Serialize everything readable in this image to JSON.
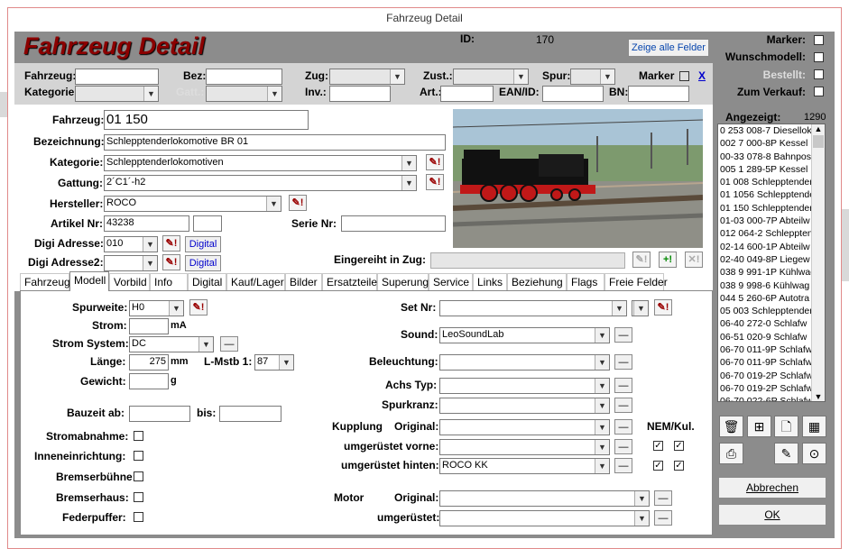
{
  "window": {
    "title": "Fahrzeug Detail"
  },
  "header": {
    "title": "Fahrzeug Detail",
    "id_label": "ID:",
    "id_value": "170",
    "show_all_button": "Zeige alle Felder"
  },
  "side_flags": [
    {
      "label": "Marker:",
      "checked": false
    },
    {
      "label": "Wunschmodell:",
      "checked": false
    },
    {
      "label": "Bestellt:",
      "checked": false,
      "disabled": true
    },
    {
      "label": "Zum Verkauf:",
      "checked": false
    }
  ],
  "filter": {
    "fahrzeug": "Fahrzeug:",
    "bez": "Bez:",
    "zug": "Zug:",
    "zust": "Zust.:",
    "spur": "Spur:",
    "marker": "Marker",
    "clear": "X",
    "kategorie": "Kategorie:",
    "gatt": "Gatt.:",
    "inv": "Inv.:",
    "art": "Art.:",
    "ean": "EAN/ID:",
    "bn": "BN:"
  },
  "form": {
    "fahrzeug_label": "Fahrzeug:",
    "fahrzeug_value": "01 150",
    "bezeichnung_label": "Bezeichnung:",
    "bezeichnung_value": "Schlepptenderlokomotive BR 01",
    "kategorie_label": "Kategorie:",
    "kategorie_value": "Schlepptenderlokomotiven",
    "gattung_label": "Gattung:",
    "gattung_value": "2´C1´-h2",
    "hersteller_label": "Hersteller:",
    "hersteller_value": "ROCO",
    "artikel_label": "Artikel Nr:",
    "artikel_value": "43238",
    "serie_label": "Serie Nr:",
    "digi1_label": "Digi Adresse:",
    "digi1_value": "010",
    "digital_btn": "Digital",
    "digi2_label": "Digi Adresse2:",
    "eingereiht_label": "Eingereiht in Zug:"
  },
  "tabs": [
    "Fahrzeug",
    "Modell",
    "Vorbild",
    "Info",
    "Digital",
    "Kauf/Lager",
    "Bilder",
    "Ersatzteile",
    "Superung",
    "Service",
    "Links",
    "Beziehung",
    "Flags",
    "Freie Felder"
  ],
  "active_tab": "Modell",
  "modell": {
    "spurweite_label": "Spurweite:",
    "spurweite_value": "H0",
    "strom_label": "Strom:",
    "strom_unit": "mA",
    "stromsystem_label": "Strom System:",
    "stromsystem_value": "DC",
    "laenge_label": "Länge:",
    "laenge_value": "275",
    "laenge_unit": "mm",
    "mstb_label": "L-Mstb 1:",
    "mstb_value": "87",
    "gewicht_label": "Gewicht:",
    "gewicht_unit": "g",
    "bauzeit_label": "Bauzeit ab:",
    "bis_label": "bis:",
    "checks": [
      "Stromabnahme:",
      "Inneneinrichtung:",
      "Bremserbühne:",
      "Bremserhaus:",
      "Federpuffer:"
    ],
    "setnr_label": "Set Nr:",
    "sound_label": "Sound:",
    "sound_value": "LeoSoundLab",
    "beleuchtung_label": "Beleuchtung:",
    "achstyp_label": "Achs Typ:",
    "spurkranz_label": "Spurkranz:",
    "kupplung_label": "Kupplung",
    "original_label": "Original:",
    "vorne_label": "umgerüstet vorne:",
    "hinten_label": "umgerüstet hinten:",
    "hinten_value": "ROCO KK",
    "nem_label": "NEM/Kul.",
    "motor_label": "Motor",
    "motor_original_label": "Original:",
    "motor_umg_label": "umgerüstet:"
  },
  "list": {
    "label": "Angezeigt:",
    "count": "1290",
    "items": [
      "0 253 008-7 Diesellok",
      "002 7 000-8P Kessel",
      "00-33 078-8 Bahnpost",
      "005 1 289-5P Kessel",
      "01 008 Schlepptender",
      "01 1056 Schlepptender",
      "01 150 Schlepptender",
      "01-03 000-7P Abteilw",
      "012 064-2 Schlepptender",
      "02-14 600-1P Abteilw",
      "02-40 049-8P Liegew",
      "038 9 991-1P Kühlwag",
      "038 9 998-6 Kühlwag",
      "044 5 260-6P Autotra",
      "05 003 Schlepptender",
      "06-40 272-0 Schlafw",
      "06-51 020-9 Schlafw",
      "06-70 011-9P Schlafw",
      "06-70 011-9P Schlafw",
      "06-70 019-2P Schlafw",
      "06-70 019-2P Schlafw",
      "06-70 022-6P Schlafw"
    ]
  },
  "buttons": {
    "abbrechen": "Abbrechen",
    "ok": "OK"
  }
}
